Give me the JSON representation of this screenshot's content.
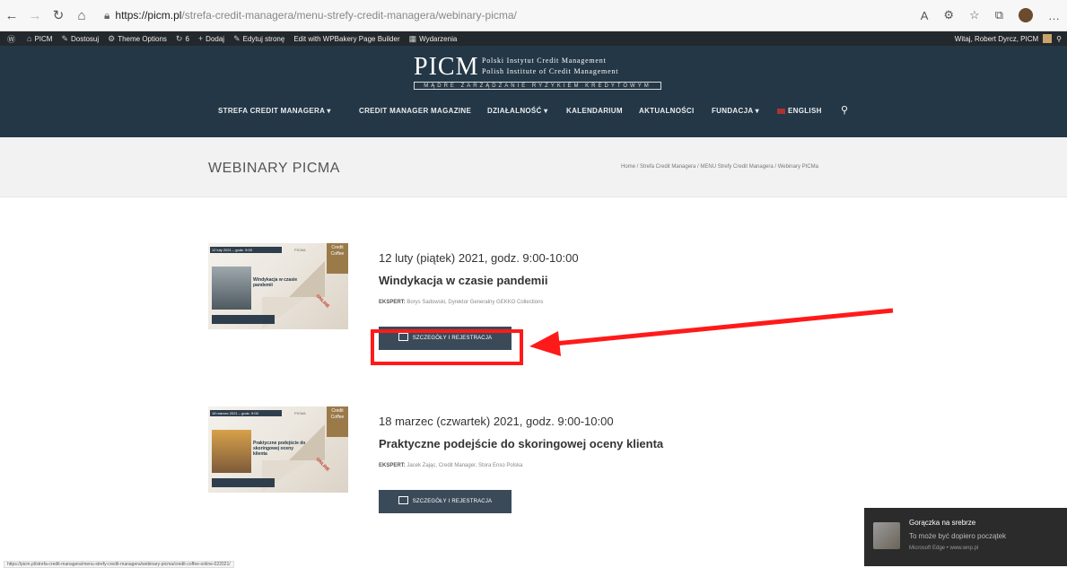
{
  "browser": {
    "url_host": "https://picm.pl",
    "url_path": "/strefa-credit-managera/menu-strefy-credit-managera/webinary-picma/",
    "icons": [
      "back-icon",
      "forward-icon",
      "refresh-icon",
      "home-icon",
      "lock-icon",
      "read-aloud-icon",
      "extension-icon",
      "favorites-icon",
      "collections-icon",
      "profile-icon",
      "more-icon"
    ]
  },
  "admin_bar": {
    "items": [
      "PICM",
      "Dostosuj",
      "Theme Options",
      "6",
      "Dodaj",
      "Edytuj stronę",
      "Edit with WPBakery Page Builder",
      "Wydarzenia"
    ],
    "greeting": "Witaj, Robert Dyrcz, PICM"
  },
  "header": {
    "logo_main": "PICM",
    "logo_sub1": "Polski Instytut Credit Management",
    "logo_sub2": "Polish Institute of Credit Management",
    "logo_strip": "MĄDRE ZARZĄDZANIE RYZYKIEM KREDYTOWYM",
    "nav": [
      "STREFA CREDIT MANAGERA ▾",
      "CREDIT MANAGER MAGAZINE",
      "DZIAŁALNOŚĆ ▾",
      "KALENDARIUM",
      "AKTUALNOŚCI",
      "FUNDACJA ▾",
      "ENGLISH"
    ]
  },
  "title_band": {
    "title": "WEBINARY PICMA",
    "breadcrumb": "Home / Strefa Credit Managera / MENU Strefy Credit Managera / Webinary PICMa"
  },
  "events": [
    {
      "date": "12 luty (piątek) 2021, godz. 9:00-10:00",
      "title": "Windykacja w czasie pandemii",
      "expert_label": "EKSPERT:",
      "expert": "Borys Sadowski, Dyrektor Generalny GEKKO Collections",
      "button": "SZCZEGÓŁY I REJESTRACJA",
      "thumb": {
        "top": "12 luty 2021 – godz. 9:00",
        "brand": "PICMA",
        "cc": "Credit Coffee",
        "heading": "Windykacja w czasie pandemii",
        "stamp": "ONLINE"
      }
    },
    {
      "date": "18 marzec (czwartek) 2021, godz. 9:00-10:00",
      "title": "Praktyczne podejście do skoringowej oceny klienta",
      "expert_label": "EKSPERT:",
      "expert": "Jacek Zając, Credit Manager, Stora Enso Polska",
      "button": "SZCZEGÓŁY I REJESTRACJA",
      "thumb": {
        "top": "18 marzec 2021 – godz. 9:00",
        "brand": "PICMA",
        "cc": "Credit Coffee",
        "heading": "Praktyczne podejście do skoringowej oceny klienta",
        "stamp": "ONLINE"
      }
    }
  ],
  "status_url": "https://picm.pl/strefa-credit-managera/menu-strefy-credit-managera/webinary-picma/credit-coffee-online-022021/",
  "toast": {
    "title": "Gorączka na srebrze",
    "body": "To może być dopiero początek",
    "source": "Microsoft Edge • www.wnp.pl"
  },
  "colors": {
    "header_bg": "#243746",
    "button_bg": "#3a4a59",
    "annotation_red": "#ff1a1a"
  }
}
